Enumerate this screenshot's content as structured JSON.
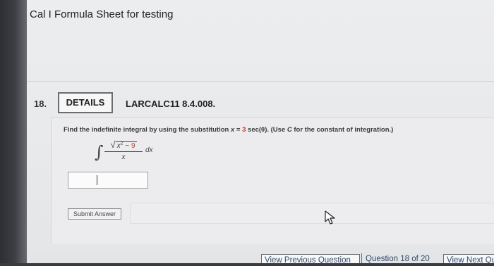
{
  "sheet": {
    "title": "Cal I Formula Sheet for testing"
  },
  "question": {
    "number": "18.",
    "details_label": "DETAILS",
    "code": "LARCALC11 8.4.008.",
    "instruction_part1": "Find the indefinite integral by using the substitution",
    "sub_var": "x",
    "sub_eq": "=",
    "sub_value": "3",
    "sub_func": "sec(θ).",
    "instruction_part2": "(Use",
    "const_var": "C",
    "instruction_part3": "for the constant of integration.)",
    "integral": {
      "sign": "∫",
      "radical": "√",
      "numerator_var": "x",
      "numerator_exp": "2",
      "numerator_minus": " − ",
      "numerator_const": "9",
      "denominator": "x",
      "differential": "dx"
    },
    "answer_value": "",
    "submit_label": "Submit Answer"
  },
  "nav": {
    "prev_label": "View Previous Question",
    "counter": "Question 18 of 20",
    "next_label": "View Next Question"
  },
  "colors": {
    "accent_red": "#d0352a",
    "nav_text": "#2d4a6d"
  }
}
